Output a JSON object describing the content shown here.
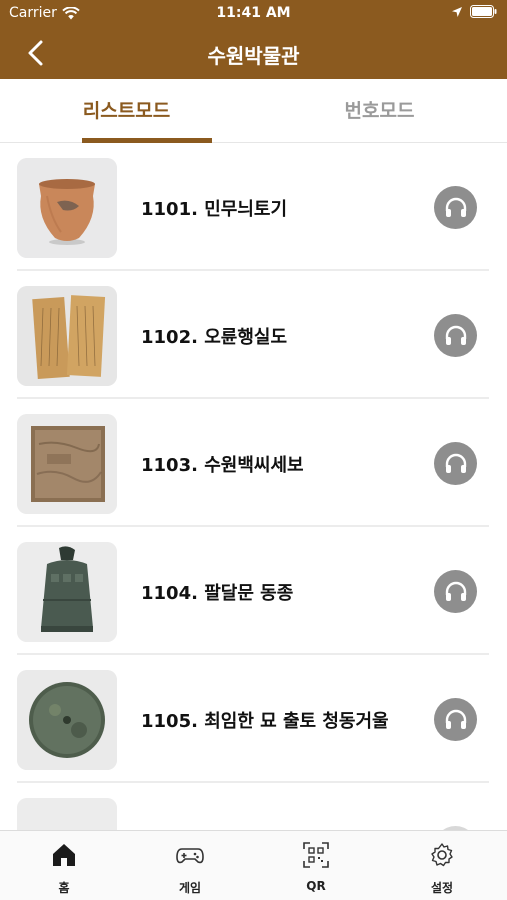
{
  "status_bar": {
    "carrier": "Carrier",
    "time": "11:41 AM"
  },
  "nav": {
    "title": "수원박물관"
  },
  "tabs": [
    {
      "label": "리스트모드",
      "active": true
    },
    {
      "label": "번호모드",
      "active": false
    }
  ],
  "items": [
    {
      "label": "1101. 민무늬토기"
    },
    {
      "label": "1102. 오륜행실도"
    },
    {
      "label": "1103. 수원백씨세보"
    },
    {
      "label": "1104. 팔달문 동종"
    },
    {
      "label": "1105. 최임한 묘 출토 청동거울"
    }
  ],
  "tabbar": [
    {
      "label": "홈",
      "icon": "home-icon"
    },
    {
      "label": "게임",
      "icon": "gamepad-icon"
    },
    {
      "label": "QR",
      "icon": "qr-icon"
    },
    {
      "label": "설정",
      "icon": "gear-icon"
    }
  ],
  "colors": {
    "brand": "#8b5a1f",
    "audio_button": "#8e8e8e",
    "inactive_tab": "#9a9a9a"
  }
}
